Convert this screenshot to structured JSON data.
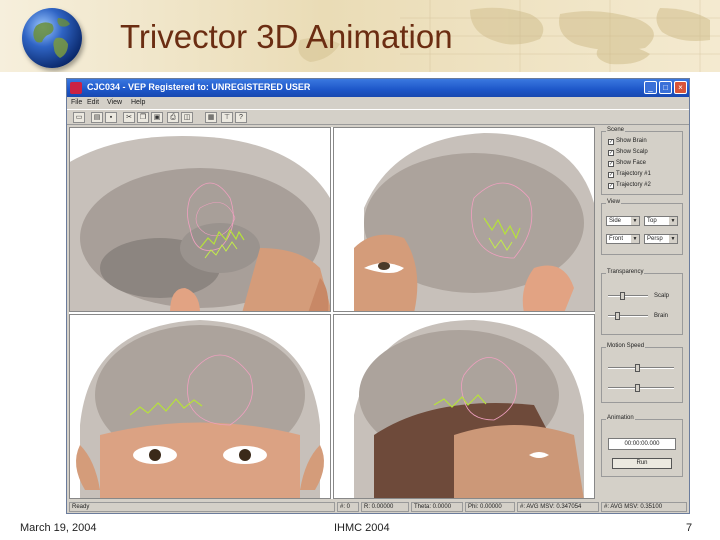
{
  "slide": {
    "title": "Trivector 3D Animation",
    "footer_date": "March 19, 2004",
    "footer_org": "IHMC 2004",
    "page_number": "7"
  },
  "window": {
    "title": "CJC034 - VEP Registered to: UNREGISTERED USER",
    "menu": [
      "File",
      "Edit",
      "View",
      "Help"
    ],
    "toolbar_icons": [
      "new-icon",
      "open-icon",
      "save-icon",
      "cut-icon",
      "copy-icon",
      "paste-icon",
      "print-icon",
      "preview-icon",
      "image-icon",
      "pin-icon",
      "help-icon"
    ]
  },
  "views": {
    "names": [
      "viewport-top-left",
      "viewport-top-right",
      "viewport-bottom-left",
      "viewport-bottom-right"
    ]
  },
  "panel": {
    "scene": {
      "label": "Scene",
      "checks": [
        {
          "label": "Show Brain",
          "checked": true
        },
        {
          "label": "Show Scalp",
          "checked": true
        },
        {
          "label": "Show Face",
          "checked": true
        },
        {
          "label": "Trajectory #1",
          "checked": true
        },
        {
          "label": "Trajectory #2",
          "checked": true
        }
      ]
    },
    "view": {
      "label": "View",
      "selects": [
        "Side",
        "Top",
        "Front",
        "Persp"
      ]
    },
    "transparency": {
      "label": "Transparency",
      "sliders": [
        {
          "label": "Scalp",
          "value": 0.35
        },
        {
          "label": "Brain",
          "value": 0.2
        }
      ]
    },
    "motion": {
      "label": "Motion Speed",
      "sliders": [
        0.45,
        0.45
      ]
    },
    "animation": {
      "label": "Animation",
      "time": "00:00:00.000",
      "button": "Run"
    }
  },
  "statusbar": {
    "ready": "Ready",
    "cells": [
      "#: 0",
      "R: 0.00000",
      "Theta: 0.0000",
      "Phi: 0.00000",
      "#: AVG MSV: 0.347054",
      "#: AVG MSV: 0.35100"
    ]
  },
  "colors": {
    "title": "#6b2d12",
    "window_title": "#1d56c8",
    "chrome": "#d4d0c8",
    "trajectory_1": "#f0a0c0",
    "trajectory_2": "#b6e23a"
  }
}
